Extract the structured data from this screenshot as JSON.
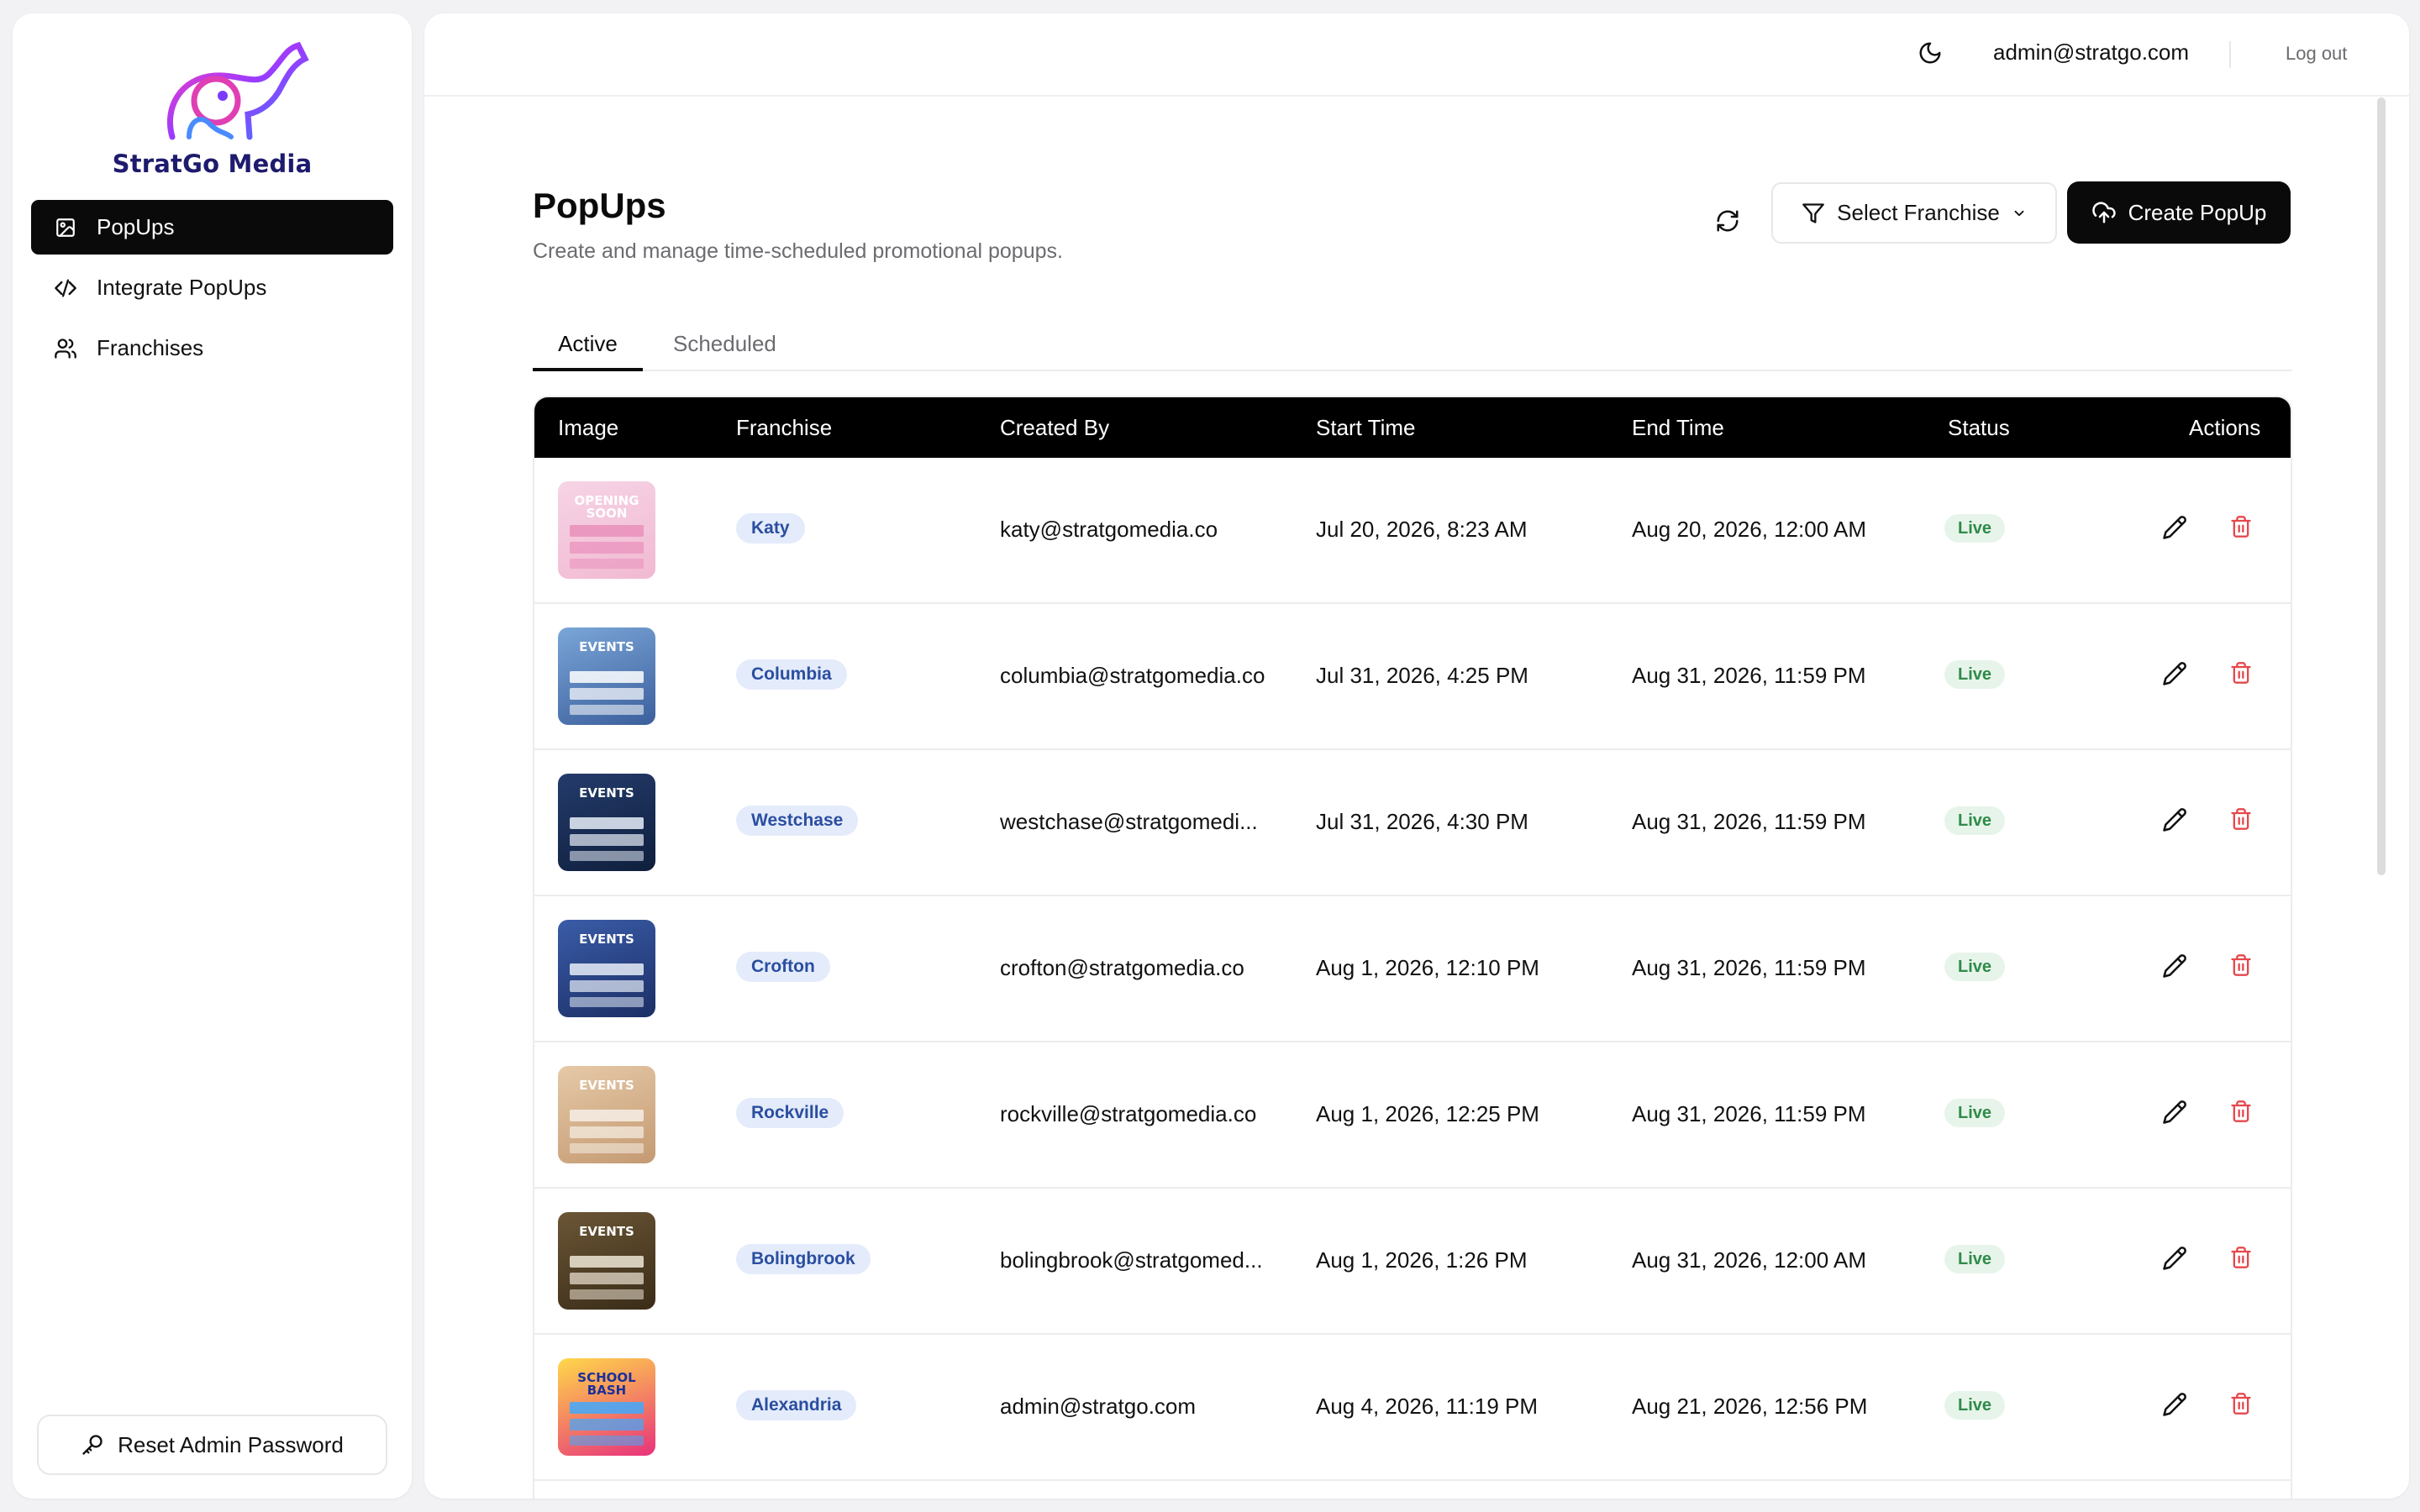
{
  "brand": {
    "name": "StratGo Media"
  },
  "sidebar": {
    "items": [
      {
        "label": "PopUps",
        "icon": "image-icon",
        "active": true
      },
      {
        "label": "Integrate PopUps",
        "icon": "code-icon",
        "active": false
      },
      {
        "label": "Franchises",
        "icon": "users-icon",
        "active": false
      }
    ],
    "reset_label": "Reset Admin Password"
  },
  "topbar": {
    "email": "admin@stratgo.com",
    "logout": "Log out"
  },
  "page": {
    "title": "PopUps",
    "subtitle": "Create and manage time-scheduled promotional popups.",
    "select_franchise": "Select Franchise",
    "create_label": "Create PopUp"
  },
  "tabs": {
    "active": "Active",
    "scheduled": "Scheduled"
  },
  "table": {
    "headers": {
      "image": "Image",
      "franchise": "Franchise",
      "created_by": "Created By",
      "start": "Start Time",
      "end": "End Time",
      "status": "Status",
      "actions": "Actions"
    },
    "rows": [
      {
        "franchise": "Katy",
        "created_by": "katy@stratgomedia.co",
        "start": "Jul 20, 2026, 8:23 AM",
        "end": "Aug 20, 2026, 12:00 AM",
        "status": "Live",
        "thumb": "opening-soon",
        "thumb_text": "OPENING SOON"
      },
      {
        "franchise": "Columbia",
        "created_by": "columbia@stratgomedia.co",
        "start": "Jul 31, 2026, 4:25 PM",
        "end": "Aug 31, 2026, 11:59 PM",
        "status": "Live",
        "thumb": "events-blue",
        "thumb_text": "EVENTS"
      },
      {
        "franchise": "Westchase",
        "created_by": "westchase@stratgomedi...",
        "start": "Jul 31, 2026, 4:30 PM",
        "end": "Aug 31, 2026, 11:59 PM",
        "status": "Live",
        "thumb": "events-navy",
        "thumb_text": "EVENTS"
      },
      {
        "franchise": "Crofton",
        "created_by": "crofton@stratgomedia.co",
        "start": "Aug 1, 2026, 12:10 PM",
        "end": "Aug 31, 2026, 11:59 PM",
        "status": "Live",
        "thumb": "events-royal",
        "thumb_text": "EVENTS"
      },
      {
        "franchise": "Rockville",
        "created_by": "rockville@stratgomedia.co",
        "start": "Aug 1, 2026, 12:25 PM",
        "end": "Aug 31, 2026, 11:59 PM",
        "status": "Live",
        "thumb": "events-tan",
        "thumb_text": "EVENTS"
      },
      {
        "franchise": "Bolingbrook",
        "created_by": "bolingbrook@stratgomed...",
        "start": "Aug 1, 2026, 1:26 PM",
        "end": "Aug 31, 2026, 12:00 AM",
        "status": "Live",
        "thumb": "events-brown",
        "thumb_text": "EVENTS"
      },
      {
        "franchise": "Alexandria",
        "created_by": "admin@stratgo.com",
        "start": "Aug 4, 2026, 11:19 PM",
        "end": "Aug 21, 2026, 12:56 PM",
        "status": "Live",
        "thumb": "school-bash",
        "thumb_text": "SCHOOL BASH"
      }
    ]
  },
  "colors": {
    "accent": "#0a0a0a",
    "badge_bg": "#e4ebfb",
    "badge_text": "#2a4ea0",
    "live_bg": "#e7f4ea",
    "live_text": "#2f8b49",
    "delete": "#e5484d"
  }
}
